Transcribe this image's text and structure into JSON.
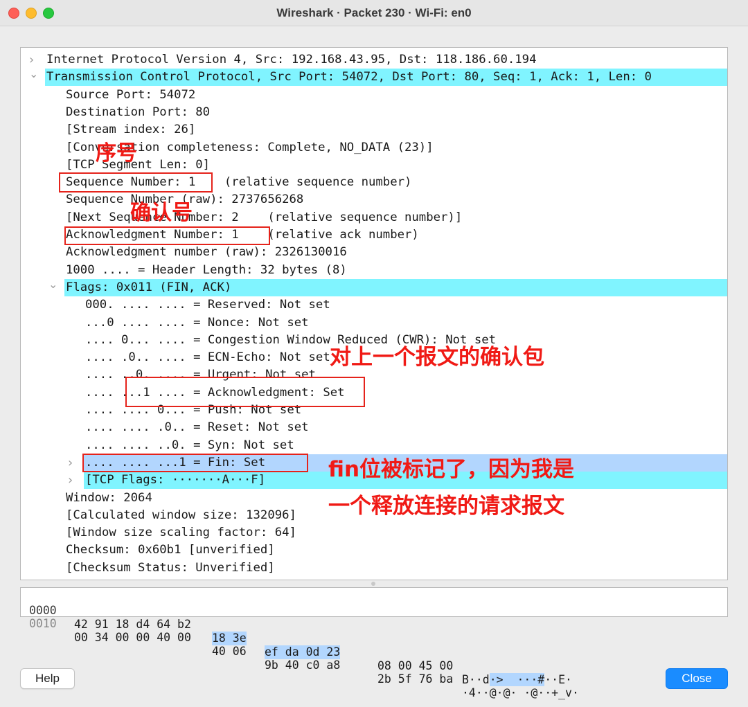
{
  "window": {
    "title": "Wireshark · Packet 230 · Wi-Fi: en0"
  },
  "tree": {
    "clipped_row": "╷",
    "lines": [
      {
        "text": "Internet Protocol Version 4, Src: 192.168.43.95, Dst: 118.186.60.194",
        "chevron": ">"
      },
      {
        "text": "Transmission Control Protocol, Src Port: 54072, Dst Port: 80, Seq: 1, Ack: 1, Len: 0",
        "chevron": "v"
      },
      {
        "text": "Source Port: 54072"
      },
      {
        "text": "Destination Port: 80"
      },
      {
        "text": "[Stream index: 26]"
      },
      {
        "text": "[Conversation completeness: Complete, NO_DATA (23)]"
      },
      {
        "text": "[TCP Segment Len: 0]"
      },
      {
        "text": "Sequence Number: 1    (relative sequence number)"
      },
      {
        "text": "Sequence Number (raw): 2737656268"
      },
      {
        "text": "[Next Sequence Number: 2    (relative sequence number)]"
      },
      {
        "text": "Acknowledgment Number: 1    (relative ack number)"
      },
      {
        "text": "Acknowledgment number (raw): 2326130016"
      },
      {
        "text": "1000 .... = Header Length: 32 bytes (8)"
      },
      {
        "text": "Flags: 0x011 (FIN, ACK)",
        "chevron": "v"
      },
      {
        "text": "000. .... .... = Reserved: Not set"
      },
      {
        "text": "...0 .... .... = Nonce: Not set"
      },
      {
        "text": ".... 0... .... = Congestion Window Reduced (CWR): Not set"
      },
      {
        "text": ".... .0.. .... = ECN-Echo: Not set"
      },
      {
        "text": ".... ..0. .... = Urgent: Not set"
      },
      {
        "text": ".... ...1 .... = Acknowledgment: Set"
      },
      {
        "text": ".... .... 0... = Push: Not set"
      },
      {
        "text": ".... .... .0.. = Reset: Not set"
      },
      {
        "text": ".... .... ..0. = Syn: Not set"
      },
      {
        "text": ".... .... ...1 = Fin: Set",
        "chevron": ">"
      },
      {
        "text": "[TCP Flags: ·······A···F]",
        "chevron": ">"
      },
      {
        "text": "Window: 2064"
      },
      {
        "text": "[Calculated window size: 132096]"
      },
      {
        "text": "[Window size scaling factor: 64]"
      },
      {
        "text": "Checksum: 0x60b1 [unverified]"
      },
      {
        "text": "[Checksum Status: Unverified]"
      }
    ]
  },
  "hex": {
    "rows": [
      {
        "offset": "0000",
        "a": "42 91 18 d4 64 b2",
        "b": "18 3e",
        "c": "ef da 0d 23",
        "d": "08 00 45 00",
        "ascii_a": "B··d",
        "ascii_b": "·>  ···#",
        "ascii_c": "··E·"
      },
      {
        "offset": "0010",
        "a": "00 34 00 00 40 00",
        "b": "40 06",
        "c": "9b 40 c0 a8",
        "d": "2b 5f 76 ba",
        "ascii_a": "·4··@·@·",
        "ascii_b": " ·@··+_v",
        "ascii_c": "·"
      }
    ]
  },
  "annotations": {
    "seq_label": "序号",
    "ack_label": "确认号",
    "ack_flag_note": "对上一个报文的确认包",
    "fin_note_line1": "fin位被标记了，因为我是",
    "fin_note_line2": "一个释放连接的请求报文"
  },
  "buttons": {
    "help": "Help",
    "close": "Close"
  },
  "colors": {
    "highlight_cyan": "#80f4ff",
    "highlight_blue": "#b2d6fe",
    "annotation_red": "#f01a15",
    "close_button": "#1a8cff"
  }
}
